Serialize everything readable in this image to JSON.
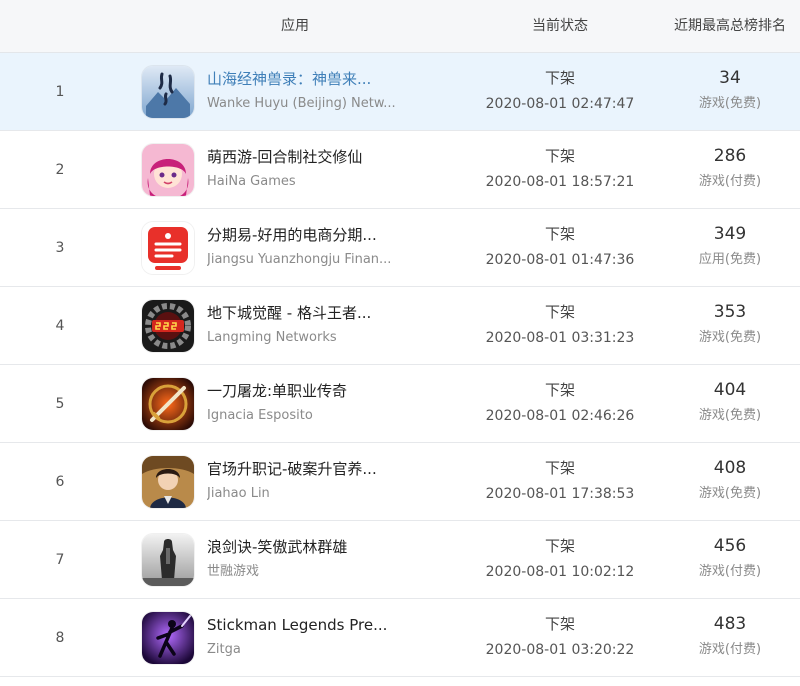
{
  "header": {
    "rank": "",
    "app": "应用",
    "status": "当前状态",
    "best_rank": "近期最高总榜排名"
  },
  "rows": [
    {
      "rank": "1",
      "name": "山海经神兽录：神兽来...",
      "developer": "Wanke Huyu (Beijing) Netw...",
      "status": "下架",
      "time": "2020-08-01 02:47:47",
      "best_rank": "34",
      "category": "游戏(免费)",
      "icon": "mountain-calligraphy-icon",
      "highlight": true
    },
    {
      "rank": "2",
      "name": "萌西游-回合制社交修仙",
      "developer": "HaiNa Games",
      "status": "下架",
      "time": "2020-08-01 18:57:21",
      "best_rank": "286",
      "category": "游戏(付费)",
      "icon": "anime-girl-icon",
      "highlight": false
    },
    {
      "rank": "3",
      "name": "分期易-好用的电商分期...",
      "developer": "Jiangsu Yuanzhongju Finan...",
      "status": "下架",
      "time": "2020-08-01 01:47:36",
      "best_rank": "349",
      "category": "应用(免费)",
      "icon": "installment-logo-icon",
      "highlight": false
    },
    {
      "rank": "4",
      "name": "地下城觉醒 - 格斗王者...",
      "developer": "Langming Networks",
      "status": "下架",
      "time": "2020-08-01 03:31:23",
      "best_rank": "353",
      "category": "游戏(免费)",
      "icon": "gear-555-icon",
      "highlight": false
    },
    {
      "rank": "5",
      "name": "一刀屠龙:单职业传奇",
      "developer": "Ignacia Esposito",
      "status": "下架",
      "time": "2020-08-01 02:46:26",
      "best_rank": "404",
      "category": "游戏(免费)",
      "icon": "sword-emblem-icon",
      "highlight": false
    },
    {
      "rank": "6",
      "name": "官场升职记-破案升官养...",
      "developer": "Jiahao Lin",
      "status": "下架",
      "time": "2020-08-01 17:38:53",
      "best_rank": "408",
      "category": "游戏(免费)",
      "icon": "officer-portrait-icon",
      "highlight": false
    },
    {
      "rank": "7",
      "name": "浪剑诀-笑傲武林群雄",
      "developer": "世融游戏",
      "status": "下架",
      "time": "2020-08-01 10:02:12",
      "best_rank": "456",
      "category": "游戏(付费)",
      "icon": "swordsman-silhouette-icon",
      "highlight": false
    },
    {
      "rank": "8",
      "name": "Stickman Legends Pre...",
      "developer": "Zitga",
      "status": "下架",
      "time": "2020-08-01 03:20:22",
      "best_rank": "483",
      "category": "游戏(付费)",
      "icon": "stickman-warrior-icon",
      "highlight": false
    }
  ]
}
